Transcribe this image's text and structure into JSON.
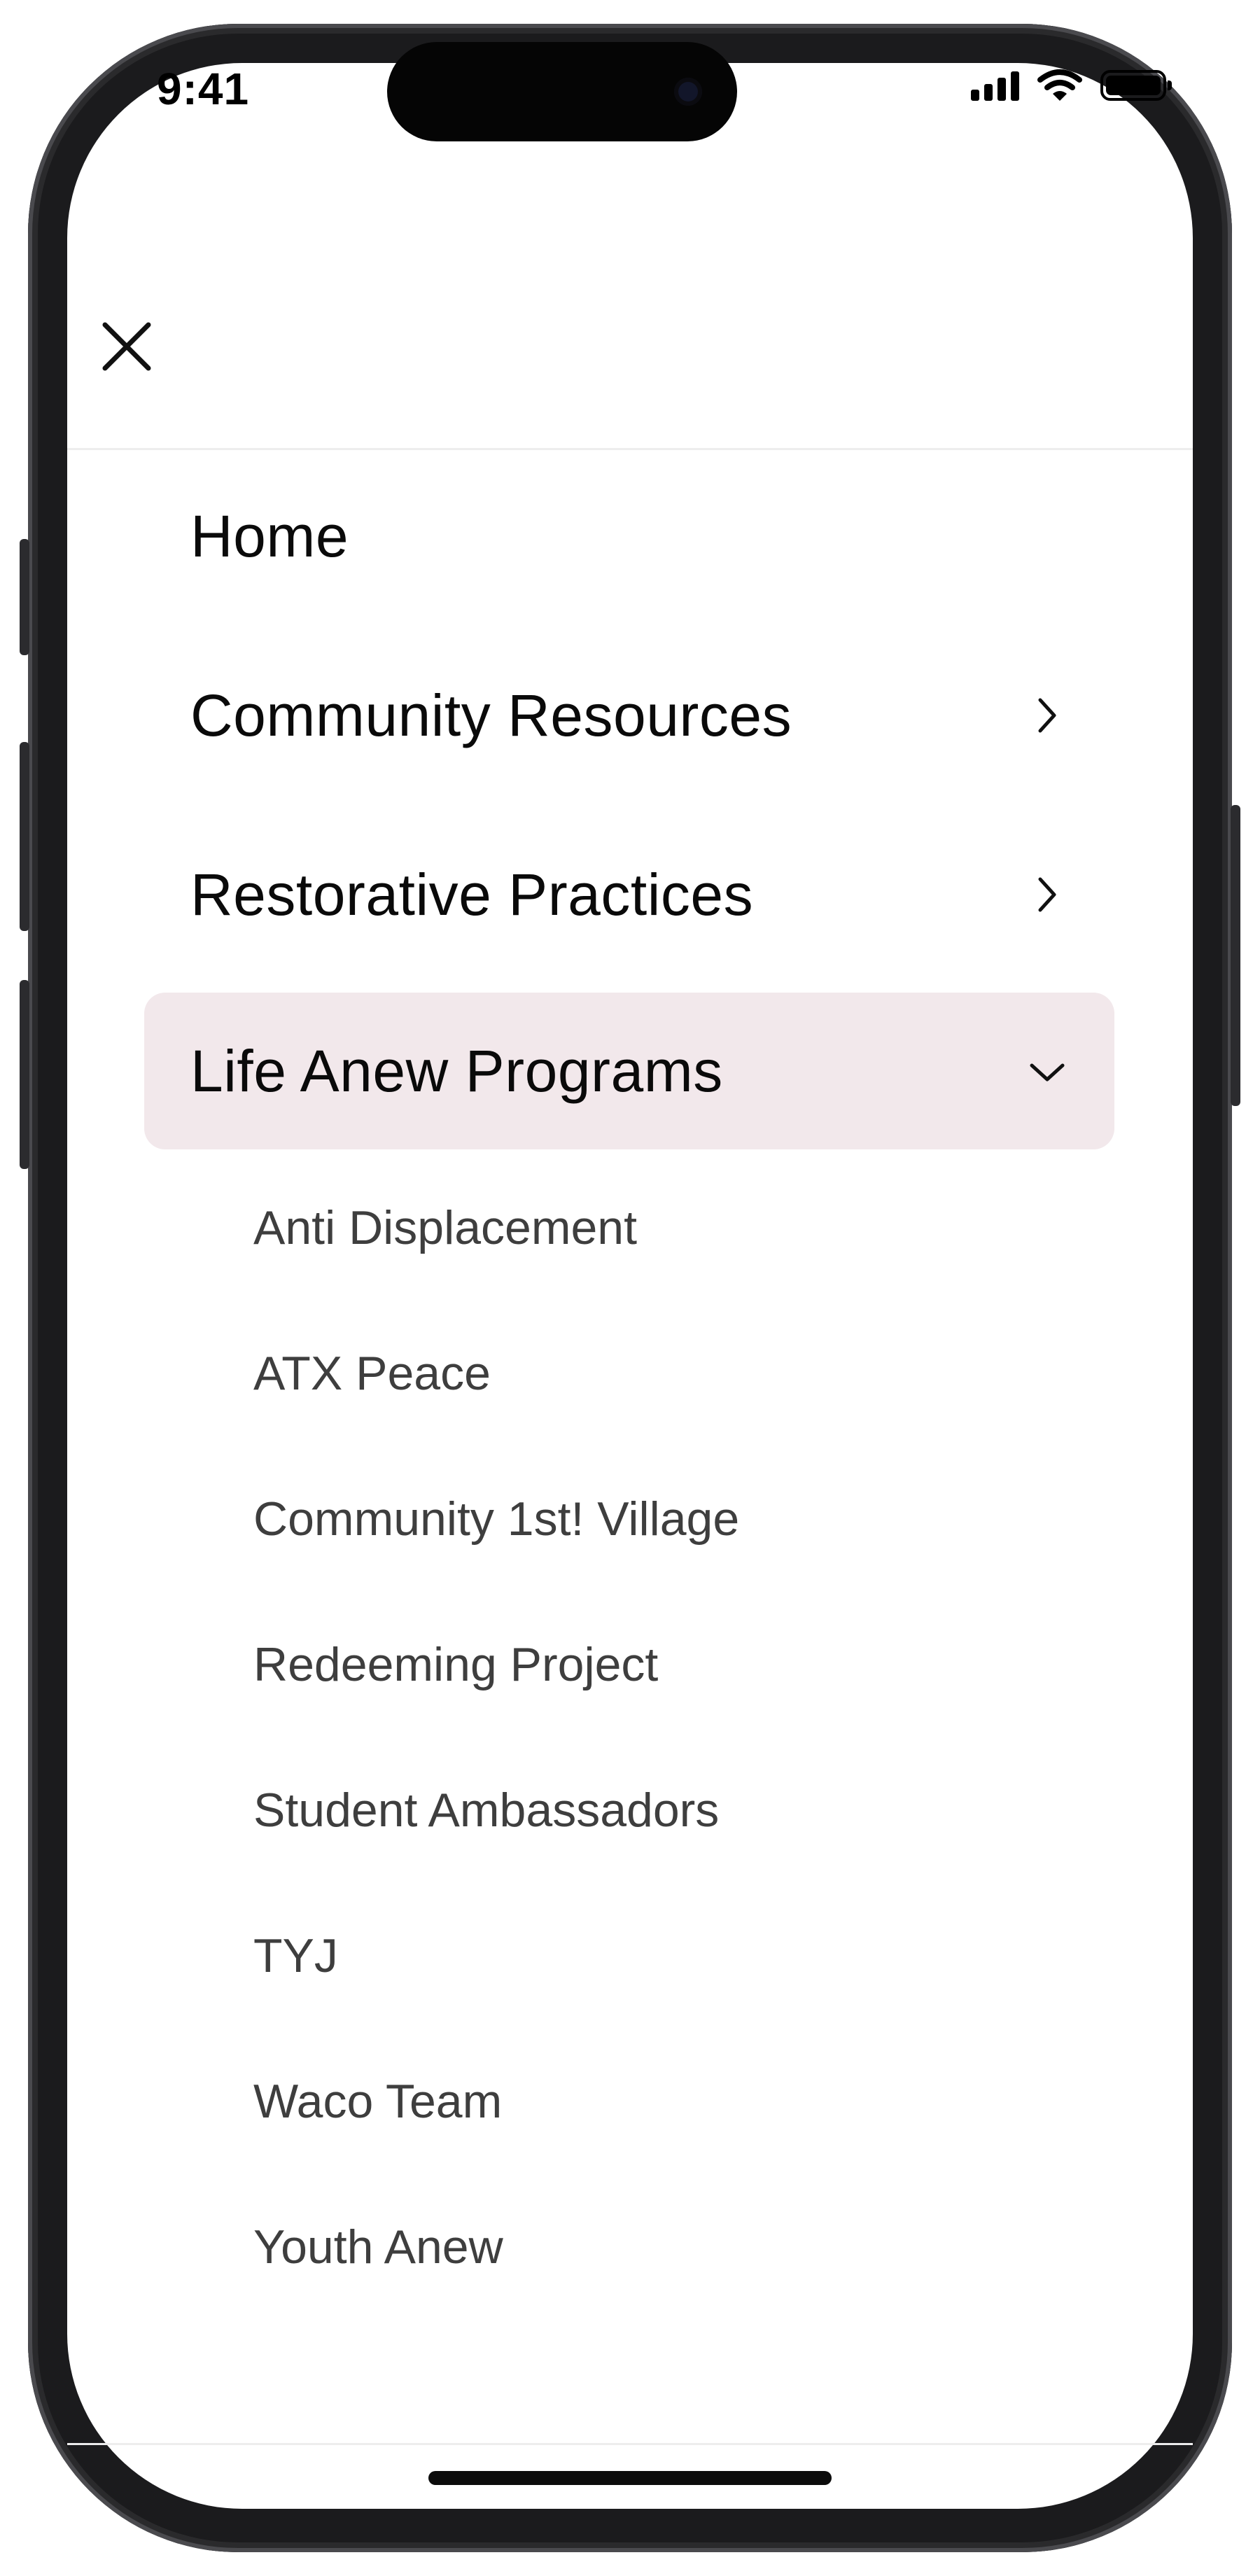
{
  "status_bar": {
    "time": "9:41",
    "icons": [
      "cellular-signal-icon",
      "wifi-icon",
      "battery-icon"
    ],
    "battery_level": 1.0
  },
  "header": {
    "close_icon": "close-icon"
  },
  "menu": {
    "items": [
      {
        "label": "Home",
        "icon": null,
        "state": "default"
      },
      {
        "label": "Community Resources",
        "icon": "chevron-right-icon",
        "state": "collapsed"
      },
      {
        "label": "Restorative Practices",
        "icon": "chevron-right-icon",
        "state": "collapsed"
      },
      {
        "label": "Life Anew Programs",
        "icon": "chevron-down-icon",
        "state": "expanded"
      }
    ],
    "submenu": [
      "Anti Displacement",
      "ATX Peace",
      "Community 1st! Village",
      "Redeeming Project",
      "Student Ambassadors",
      "TYJ",
      "Waco Team",
      "Youth Anew"
    ]
  },
  "colors": {
    "active_item_background": "#f2e8eb",
    "primary_text": "#0a0a0a",
    "secondary_text": "#3e3e3e",
    "divider": "#ededed"
  }
}
